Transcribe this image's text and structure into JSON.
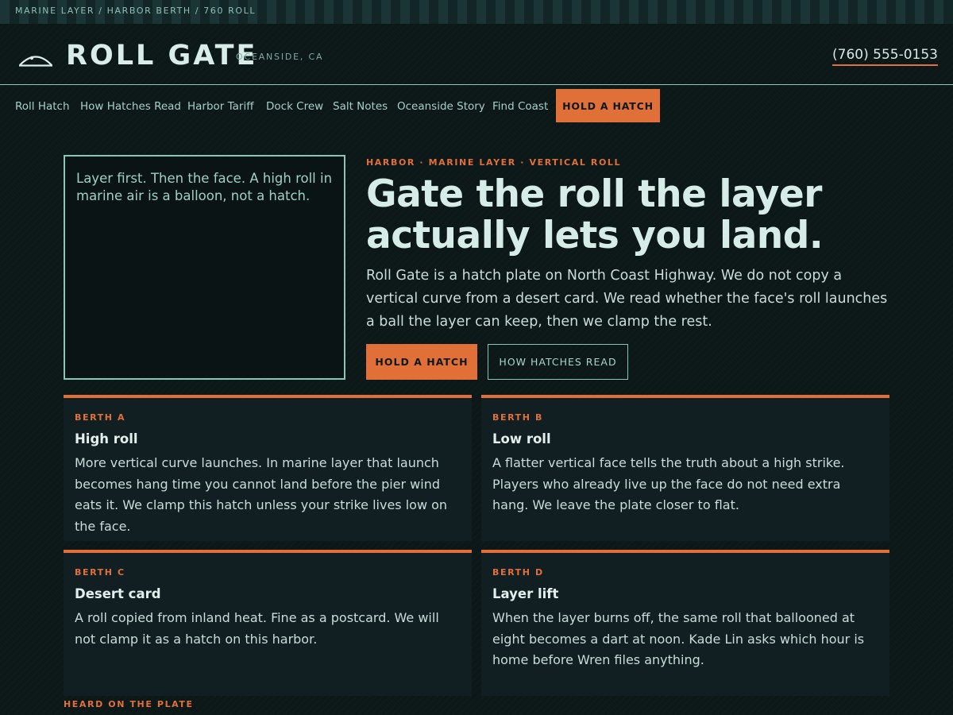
{
  "topbar": {
    "breadcrumb": "MARINE LAYER / HARBOR BERTH / 760 ROLL"
  },
  "header": {
    "brand": "ROLL GATE",
    "location": "OCEANSIDE, CA",
    "phone": "(760) 555-0153"
  },
  "nav": {
    "items": [
      {
        "label": "Roll Hatch"
      },
      {
        "label": "How Hatches Read"
      },
      {
        "label": "Harbor Tariff"
      },
      {
        "label": "Dock Crew"
      },
      {
        "label": "Salt Notes"
      },
      {
        "label": "Oceanside Story"
      },
      {
        "label": "Find Coast"
      }
    ],
    "cta": "HOLD A HATCH"
  },
  "hero": {
    "quote": "Layer first. Then the face. A high roll in marine air is a balloon, not a hatch.",
    "eyebrow": "HARBOR · MARINE LAYER · VERTICAL ROLL",
    "headline": "Gate the roll the layer actually lets you land.",
    "lede": "Roll Gate is a hatch plate on North Coast Highway. We do not copy a vertical curve from a desert card. We read whether the face's roll launches a ball the layer can keep, then we clamp the rest.",
    "primary_button": "HOLD A HATCH",
    "secondary_button": "HOW HATCHES READ"
  },
  "cards": [
    {
      "tag": "BERTH A",
      "title": "High roll",
      "body": "More vertical curve launches. In marine layer that launch becomes hang time you cannot land before the pier wind eats it. We clamp this hatch unless your strike lives low on the face."
    },
    {
      "tag": "BERTH B",
      "title": "Low roll",
      "body": "A flatter vertical face tells the truth about a high strike. Players who already live up the face do not need extra hang. We leave the plate closer to flat."
    },
    {
      "tag": "BERTH C",
      "title": "Desert card",
      "body": "A roll copied from inland heat. Fine as a postcard. We will not clamp it as a hatch on this harbor."
    },
    {
      "tag": "BERTH D",
      "title": "Layer lift",
      "body": "When the layer burns off, the same roll that ballooned at eight becomes a dart at noon. Kade Lin asks which hour is home before Wren files anything."
    }
  ],
  "footer": {
    "section_label": "HEARD ON THE PLATE"
  },
  "colors": {
    "accent": "#e07038",
    "teal": "#86c8b4",
    "background": "#0c1718",
    "card": "#111f23"
  },
  "icons": {
    "logo": "dome-roll-logo-icon"
  }
}
